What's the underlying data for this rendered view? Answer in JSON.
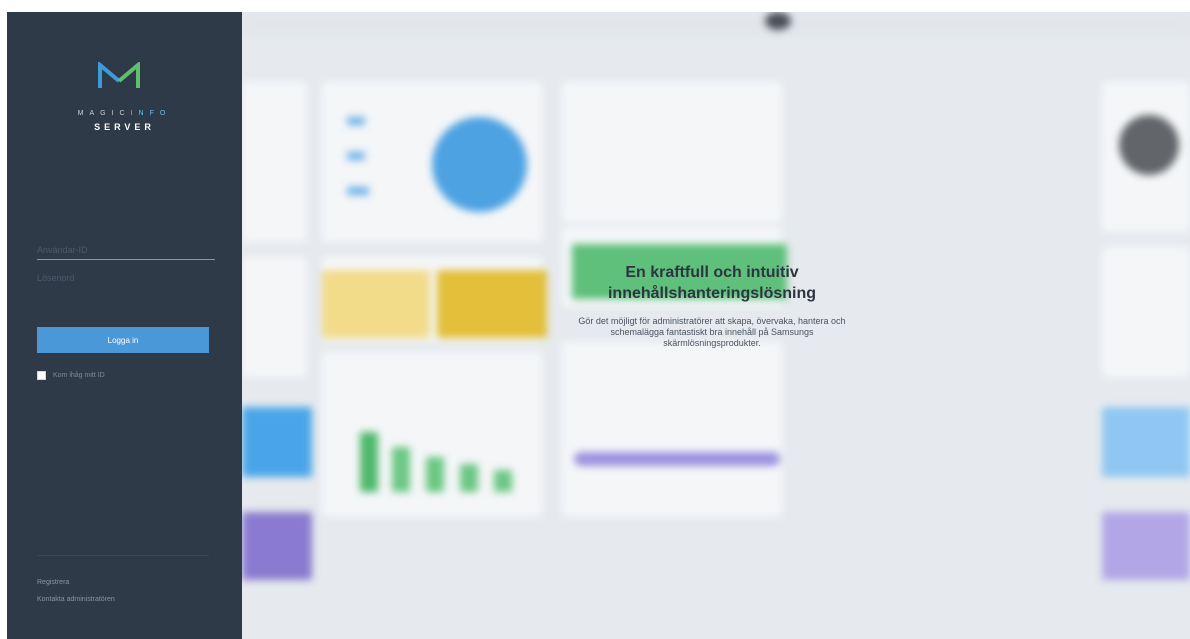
{
  "brand": {
    "top_prefix": "MAGIC",
    "top_accent": "INFO",
    "bottom": "SERVER",
    "colors": {
      "green": "#5fbf6e",
      "blue": "#3e9bd9",
      "panel": "#2f3a48"
    }
  },
  "login": {
    "user_placeholder": "Användar-ID",
    "password_placeholder": "Lösenord",
    "login_label": "Logga in",
    "remember_label": "Kom ihåg mitt ID",
    "register_label": "Registrera",
    "contact_label": "Kontakta administratören",
    "button_color": "#4a98d8"
  },
  "hero": {
    "title_line1": "En kraftfull och intuitiv",
    "title_line2": "innehållshanteringslösning",
    "subtitle_line1": "Gör det möjligt för administratörer att skapa, övervaka, hantera och",
    "subtitle_line2": "schemalägga fantastiskt bra innehåll på Samsungs",
    "subtitle_line3": "skärmlösningsprodukter."
  }
}
